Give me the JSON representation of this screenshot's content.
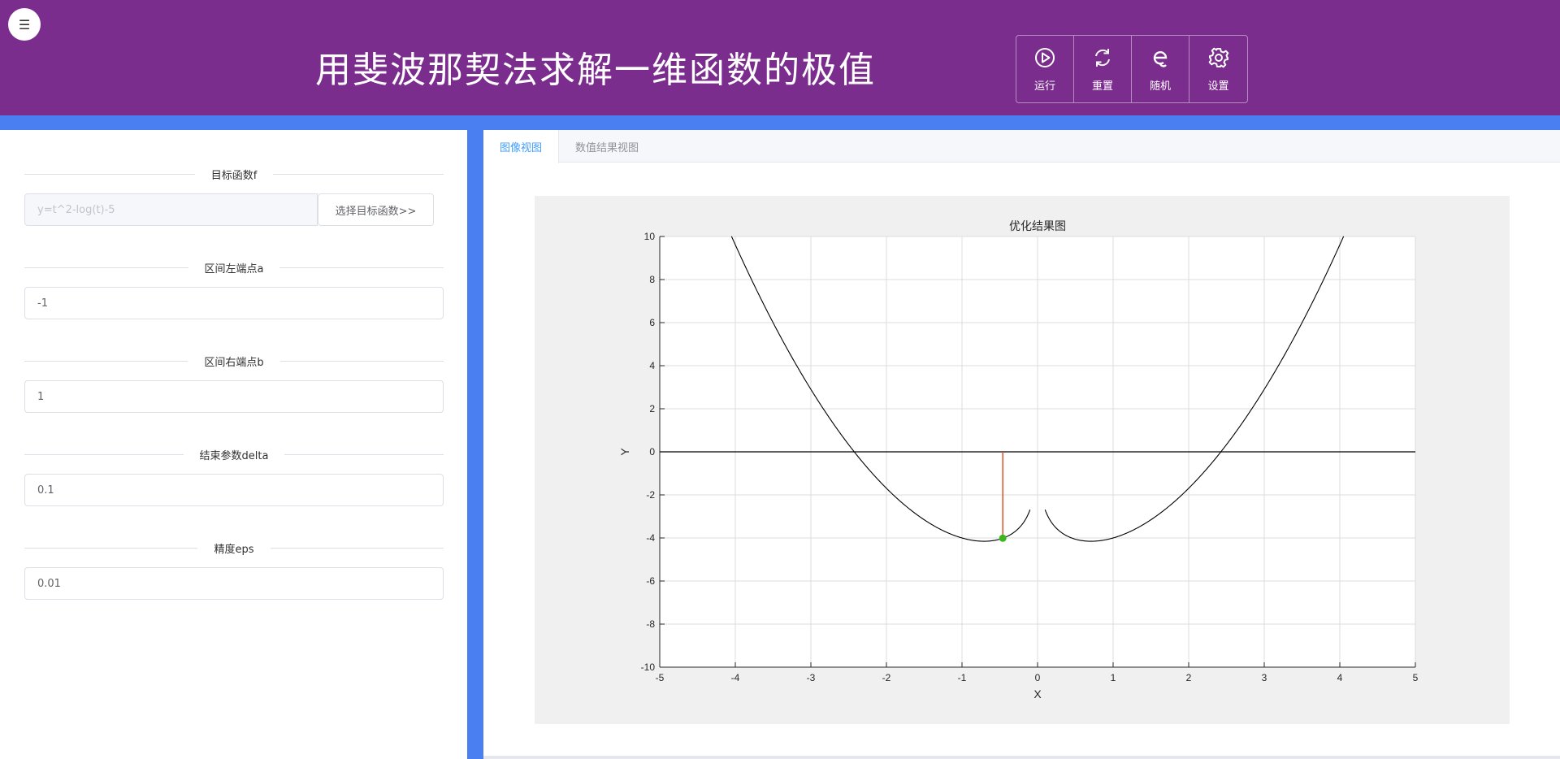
{
  "header": {
    "menu_icon": "☰",
    "title": "用斐波那契法求解一维函数的极值",
    "toolbar": [
      {
        "label": "运行",
        "icon": "play-icon"
      },
      {
        "label": "重置",
        "icon": "refresh-icon"
      },
      {
        "label": "随机",
        "icon": "random-icon"
      },
      {
        "label": "设置",
        "icon": "gear-icon"
      }
    ]
  },
  "form": {
    "target": {
      "label": "目标函数f",
      "placeholder": "y=t^2-log(t)-5",
      "button": "选择目标函数>>"
    },
    "a": {
      "label": "区间左端点a",
      "value": "-1"
    },
    "b": {
      "label": "区间右端点b",
      "value": "1"
    },
    "delta": {
      "label": "结束参数delta",
      "value": "0.1"
    },
    "eps": {
      "label": "精度eps",
      "value": "0.01"
    }
  },
  "tabs": [
    {
      "label": "图像视图",
      "active": true
    },
    {
      "label": "数值结果视图",
      "active": false
    }
  ],
  "chart_data": {
    "type": "line",
    "title": "优化结果图",
    "xlabel": "X",
    "ylabel": "Y",
    "xlim": [
      -5,
      5
    ],
    "ylim": [
      -10,
      10
    ],
    "xticks": [
      -5,
      -4,
      -3,
      -2,
      -1,
      0,
      1,
      2,
      3,
      4,
      5
    ],
    "yticks": [
      -10,
      -8,
      -6,
      -4,
      -2,
      0,
      2,
      4,
      6,
      8,
      10
    ],
    "grid": true,
    "function": "y=t^2-log(|t|)-5",
    "curve_domains": [
      [
        -4.05,
        -0.1
      ],
      [
        0.1,
        4.05
      ]
    ],
    "hline_y": 0,
    "optimum": {
      "x": -0.46,
      "y": -4.01
    },
    "colors": {
      "curve": "#000000",
      "marker_line": "#d9541e",
      "point": "#3cb521",
      "axes_bg": "#ffffff",
      "figure_bg": "#f0f0f0",
      "grid": "#dcdcdc"
    }
  }
}
